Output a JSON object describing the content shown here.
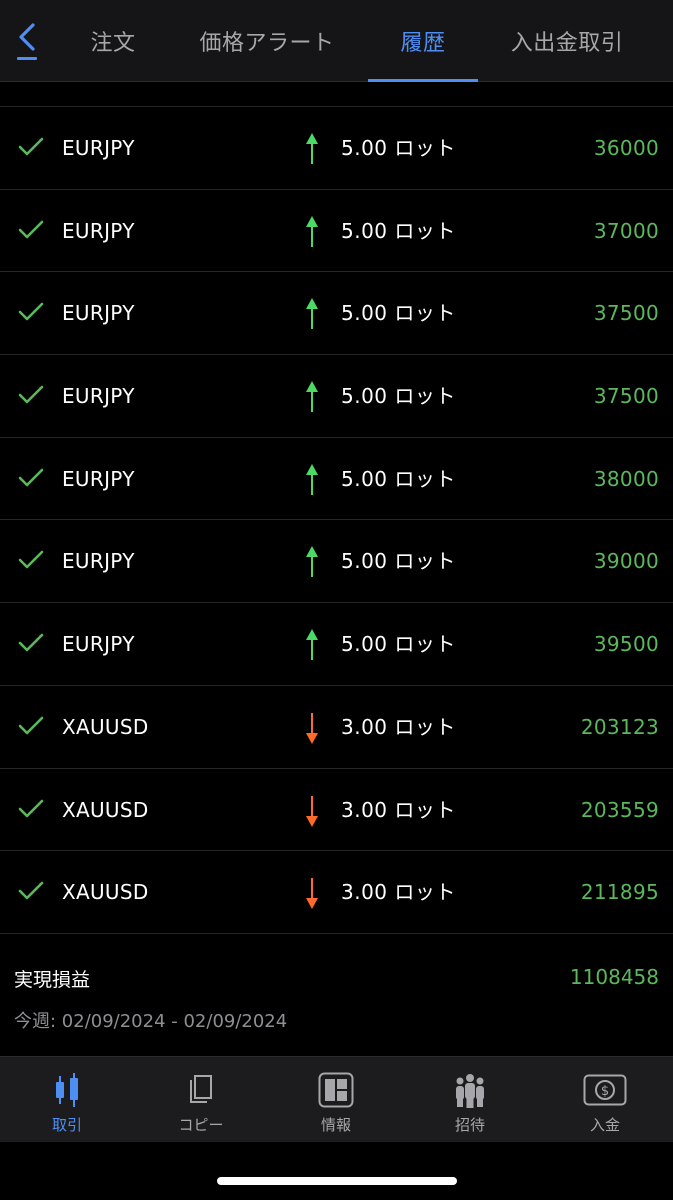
{
  "tabs": {
    "orders": "注文",
    "price_alerts": "価格アラート",
    "history": "履歴",
    "deposit_withdrawal": "入出金取引"
  },
  "trades": [
    {
      "symbol": "EURJPY",
      "direction": "up",
      "lots": "5.00 ロット",
      "profit": "36000"
    },
    {
      "symbol": "EURJPY",
      "direction": "up",
      "lots": "5.00 ロット",
      "profit": "37000"
    },
    {
      "symbol": "EURJPY",
      "direction": "up",
      "lots": "5.00 ロット",
      "profit": "37500"
    },
    {
      "symbol": "EURJPY",
      "direction": "up",
      "lots": "5.00 ロット",
      "profit": "37500"
    },
    {
      "symbol": "EURJPY",
      "direction": "up",
      "lots": "5.00 ロット",
      "profit": "38000"
    },
    {
      "symbol": "EURJPY",
      "direction": "up",
      "lots": "5.00 ロット",
      "profit": "39000"
    },
    {
      "symbol": "EURJPY",
      "direction": "up",
      "lots": "5.00 ロット",
      "profit": "39500"
    },
    {
      "symbol": "XAUUSD",
      "direction": "down",
      "lots": "3.00 ロット",
      "profit": "203123"
    },
    {
      "symbol": "XAUUSD",
      "direction": "down",
      "lots": "3.00 ロット",
      "profit": "203559"
    },
    {
      "symbol": "XAUUSD",
      "direction": "down",
      "lots": "3.00 ロット",
      "profit": "211895"
    }
  ],
  "summary": {
    "label": "実現損益",
    "total": "1108458",
    "range": "今週: 02/09/2024 - 02/09/2024"
  },
  "bottom_nav": {
    "trade": "取引",
    "copy": "コピー",
    "info": "情報",
    "invite": "招待",
    "deposit": "入金"
  },
  "colors": {
    "accent": "#4d8ff2",
    "profit": "#5cb85c",
    "buy": "#4cd964",
    "sell": "#ff6a2a",
    "background": "#000000"
  }
}
